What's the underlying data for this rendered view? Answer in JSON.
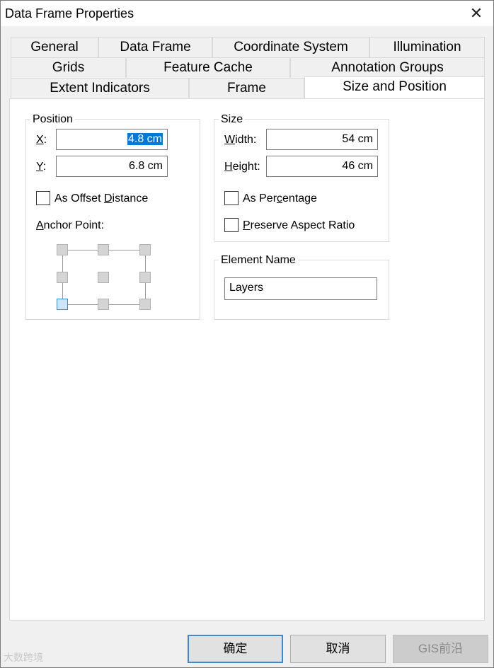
{
  "window": {
    "title": "Data Frame Properties",
    "close_symbol": "✕"
  },
  "tabs": {
    "row1": [
      "General",
      "Data Frame",
      "Coordinate System",
      "Illumination"
    ],
    "row2": [
      "Grids",
      "Feature Cache",
      "Annotation Groups"
    ],
    "row3": [
      "Extent Indicators",
      "Frame",
      "Size and Position"
    ],
    "active": "Size and Position"
  },
  "position": {
    "legend": "Position",
    "x_label_key": "X",
    "x_label_rest": ":",
    "x_value": "4.8 cm",
    "y_label_key": "Y",
    "y_label_rest": ":",
    "y_value": "6.8 cm",
    "offset_pre": "As Offset ",
    "offset_key": "D",
    "offset_post": "istance",
    "offset_checked": false,
    "anchor_key": "A",
    "anchor_rest": "nchor Point:",
    "anchor_selected": "bottom-left"
  },
  "size": {
    "legend": "Size",
    "width_key": "W",
    "width_rest": "idth:",
    "width_value": "54 cm",
    "height_key": "H",
    "height_rest": "eight:",
    "height_value": "46 cm",
    "percentage_pre": "As Per",
    "percentage_key": "c",
    "percentage_post": "entage",
    "percentage_checked": false,
    "aspect_key": "P",
    "aspect_rest": "reserve Aspect Ratio",
    "aspect_checked": false
  },
  "element_name": {
    "legend": "Element Name",
    "value": "Layers"
  },
  "buttons": {
    "ok": "确定",
    "cancel": "取消",
    "apply": "GIS前沿"
  },
  "watermark": {
    "left": "大数跨境"
  }
}
